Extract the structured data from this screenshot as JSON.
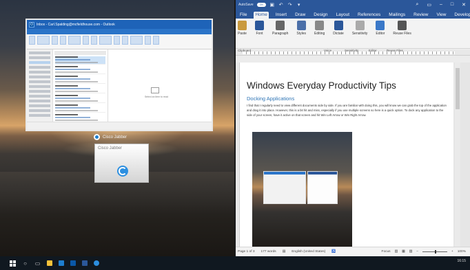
{
  "outlook": {
    "title": "Inbox - Carl.Spalding@mcfieldhouse.com - Outlook",
    "empty_message": "Select an item to read"
  },
  "jabber": {
    "label": "Cisco Jabber",
    "window_title": "Cisco Jabber"
  },
  "word": {
    "autosave_label": "AutoSave",
    "autosave_state": "On",
    "tabs": [
      "File",
      "Home",
      "Insert",
      "Draw",
      "Design",
      "Layout",
      "References",
      "Mailings",
      "Review",
      "View",
      "Developer",
      "Help"
    ],
    "active_tab": "Home",
    "ribbon_groups": [
      {
        "label": "Paste",
        "sub": "",
        "color": "#c99a3e"
      },
      {
        "label": "Font",
        "sub": "",
        "color": "#2b579a"
      },
      {
        "label": "Paragraph",
        "sub": "",
        "color": "#666666"
      },
      {
        "label": "Styles",
        "sub": "",
        "color": "#4b6fa8"
      },
      {
        "label": "Editing",
        "sub": "",
        "color": "#888888"
      },
      {
        "label": "Dictate",
        "sub": "",
        "color": "#2b579a"
      },
      {
        "label": "Sensitivity",
        "sub": "",
        "color": "#aaaaaa"
      },
      {
        "label": "Editor",
        "sub": "",
        "color": "#3a78c8"
      },
      {
        "label": "Reuse Files",
        "sub": "",
        "color": "#555555"
      }
    ],
    "group_labels": {
      "clipboard": "Clipboard",
      "voice": "Voice",
      "sensitivity": "Sensitivity",
      "editor": "Editor",
      "reuse": "Reuse Files"
    },
    "doc": {
      "title": "Windows Everyday Productivity Tips",
      "heading": "Docking Applications",
      "paragraph": "I find that I regularly need to view different documents side by side. If you are familiar with doing this, you will know we can grab the top of the application and drag it into place. However, this is a bit hit and miss, especially if you use multiple screens so here is a quick option. To dock any application to the side of your screen, have it active on that screen and hit Win Left Arrow or Win Right Arrow."
    },
    "status": {
      "page": "Page 1 of 3",
      "words": "177 words",
      "language": "English (United States)",
      "focus": "Focus",
      "zoom": "100%"
    }
  },
  "taskbar": {
    "clock_time": "16:15"
  }
}
